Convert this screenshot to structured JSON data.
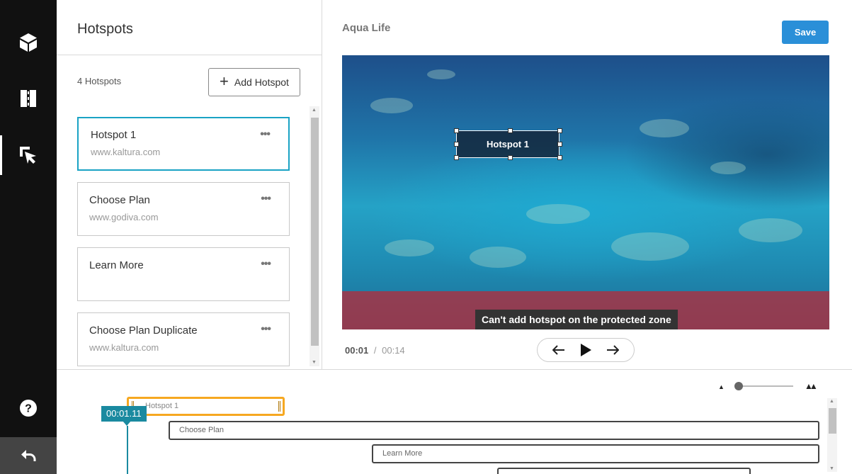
{
  "panel": {
    "title": "Hotspots",
    "count_label": "4 Hotspots",
    "add_button_label": "Add Hotspot"
  },
  "hotspots": [
    {
      "title": "Hotspot 1",
      "url": "www.kaltura.com",
      "selected": true
    },
    {
      "title": "Choose Plan",
      "url": "www.godiva.com",
      "selected": false
    },
    {
      "title": "Learn More",
      "url": "",
      "selected": false
    },
    {
      "title": "Choose Plan Duplicate",
      "url": "www.kaltura.com",
      "selected": false
    }
  ],
  "card_menu_glyph": "•••",
  "preview": {
    "video_name": "Aqua Life",
    "save_label": "Save",
    "hotspot_label": "Hotspot 1",
    "protected_message": "Can't add hotspot on the protected zone"
  },
  "playback": {
    "current_time": "00:01",
    "separator": "/",
    "duration": "00:14"
  },
  "timeline": {
    "playhead_time": "00:01.11",
    "bars": [
      "Hotspot 1",
      "Choose Plan",
      "Learn More",
      ""
    ]
  },
  "colors": {
    "accent": "#1aa3c4",
    "save": "#2a8fd8",
    "selected_bar": "#f6a821",
    "playhead": "#1a8aa0",
    "protected_zone": "#b22d3c"
  },
  "icons": {
    "rail": [
      "cube-icon",
      "layout-icon",
      "cursor-click-icon"
    ],
    "help": "help-icon",
    "back": "undo-icon"
  }
}
